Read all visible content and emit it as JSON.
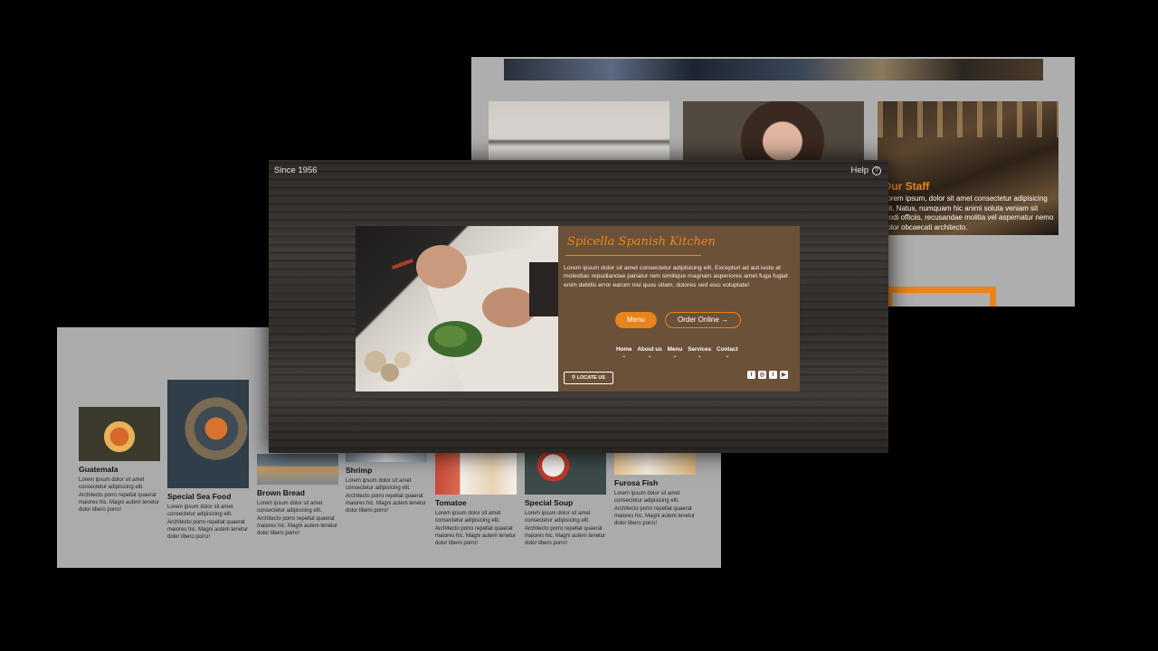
{
  "staff_page": {
    "caption_title": "Our Staff",
    "caption_text": "Lorem ipsum, dolor sit amet consectetur adipisicing elit. Natus, numquam hic animi soluta veniam sit modi officiis, recusandae molitia vel aspernatur nemo dolor obcaecati architecto."
  },
  "menu_page": {
    "dishes": [
      {
        "name": "Guatemala",
        "desc": "Lorem ipsum dolor sit amet consectetur adipisicing elit. Architecto porro repellat quaerat maiores hic. Magni autem tenetur dolor libero porro!"
      },
      {
        "name": "Special Sea Food",
        "desc": "Lorem ipsum dolor sit amet consectetur adipisicing elit. Architecto porro repellat quaerat maiores hic. Magni autem tenetur dolor libero porro!"
      },
      {
        "name": "Brown Bread",
        "desc": "Lorem ipsum dolor sit amet consectetur adipisicing elit. Architecto porro repellat quaerat maiores hic. Magni autem tenetur dolor libero porro!"
      },
      {
        "name": "Shrimp",
        "desc": "Lorem ipsum dolor sit amet consectetur adipisicing elit. Architecto porro repellat quaerat maiores hic. Magni autem tenetur dolor libero porro!"
      },
      {
        "name": "Tomatoe",
        "desc": "Lorem ipsum dolor sit amet consectetur adipisicing elit. Architecto porro repellat quaerat maiores hic. Magni autem tenetur dolor libero porro!"
      },
      {
        "name": "Special Soup",
        "desc": "Lorem ipsum dolor sit amet consectetur adipisicing elit. Architecto porro repellat quaerat maiores hic. Magni autem tenetur dolor libero porro!"
      },
      {
        "name": "Furosa Fish",
        "desc": "Lorem ipsum dolor sit amet consectetur adipisicing elit. Architecto porro repellat quaerat maiores hic. Magni autem tenetur dolor libero porro!"
      }
    ]
  },
  "hero": {
    "since": "Since 1956",
    "help": "Help",
    "help_icon": "?",
    "title": "Spicella Spanish Kitchen",
    "text": "Lorem ipsum dolor sit amet consectetur adipisicing elit. Excepturi ad aut iusto at molestias repudiandae pariatur rem similique magnam asperiores amet fuga fugiat enim debitis error earum nisi quos ullam, dolores sed eius voluptate!",
    "menu_button": "Menu",
    "order_button": "Order Online →",
    "nav": [
      "Home",
      "About us",
      "Menu",
      "Services",
      "Contact"
    ],
    "locate_button": "LOCATE US",
    "socials": [
      "facebook",
      "instagram",
      "twitter",
      "youtube"
    ],
    "colors": {
      "accent": "#e8841c",
      "card": "#6b5138"
    }
  }
}
